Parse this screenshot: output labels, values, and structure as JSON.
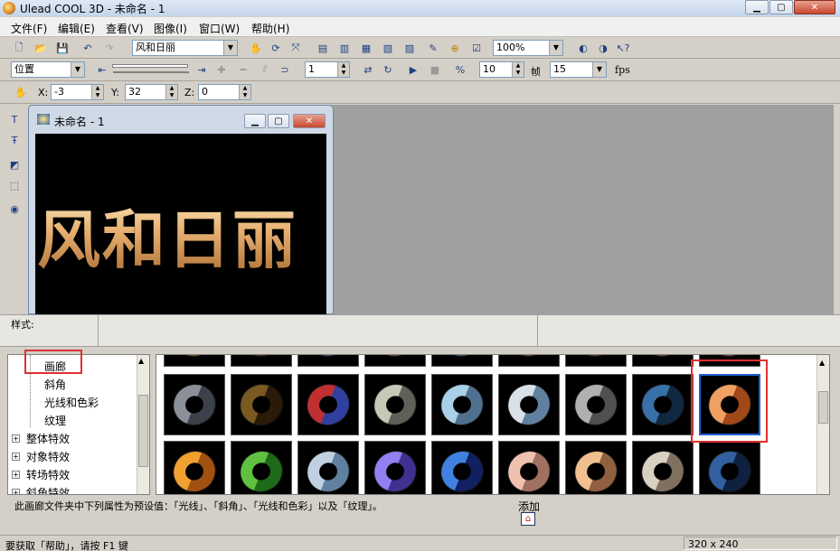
{
  "window": {
    "title": "Ulead COOL 3D - 未命名 - 1"
  },
  "menu": [
    "文件(F)",
    "编辑(E)",
    "查看(V)",
    "图像(I)",
    "窗口(W)",
    "帮助(H)"
  ],
  "toolbar1": {
    "text_object": "风和日丽",
    "zoom": "100%"
  },
  "toolbar2": {
    "mode": "位置",
    "frame": "1",
    "frames": "10",
    "frames_label": "帧",
    "fps_value": "15",
    "fps_label": "fps"
  },
  "toolbar3": {
    "x_label": "X:",
    "x_value": "-3",
    "y_label": "Y:",
    "y_value": "32",
    "z_label": "Z:",
    "z_value": "0"
  },
  "doc": {
    "title": "未命名 - 1",
    "text": "风和日丽"
  },
  "style_label": "样式:",
  "tree": {
    "items": [
      "画廊",
      "斜角",
      "光线和色彩",
      "纹理"
    ],
    "groups": [
      "整体特效",
      "对象特效",
      "转场特效",
      "斜角特效"
    ]
  },
  "description": "此画廊文件夹中下列属性为预设值：「光线」、「斜角」、「光线和色彩」以及「纹理」。",
  "add_label": "添加",
  "status": {
    "help": "要获取「帮助」，请按 F1 键",
    "size": "320 x 240"
  },
  "thumbs_row1": [
    [
      "#8a8f99",
      "#3c4048"
    ],
    [
      "#7a5a20",
      "#2a1a08"
    ],
    [
      "#c03030",
      "#3040a0"
    ],
    [
      "#c8c8b8",
      "#606058"
    ],
    [
      "#a8d0e8",
      "#507090"
    ],
    [
      "#d8e0e8",
      "#6080a0"
    ],
    [
      "#b0b0b0",
      "#505050"
    ],
    [
      "#3870a8",
      "#102840"
    ],
    [
      "#f0a060",
      "#a04818"
    ]
  ],
  "thumbs_row2": [
    [
      "#f0a030",
      "#a05010"
    ],
    [
      "#60c040",
      "#1f6a18"
    ],
    [
      "#c0d0e0",
      "#6080a0"
    ],
    [
      "#9080f0",
      "#403090"
    ],
    [
      "#4080e0",
      "#102060"
    ],
    [
      "#f0c0b0",
      "#a07060"
    ],
    [
      "#f0c090",
      "#906040"
    ],
    [
      "#d8d0c0",
      "#807060"
    ],
    [
      "#3060a0",
      "#102040"
    ]
  ],
  "thumbs_row0": [
    [
      "#e0c070",
      "#806020"
    ],
    [
      "#907060",
      "#403028"
    ],
    [
      "#c0c0d0",
      "#505068"
    ],
    [
      "#d0b090",
      "#705030"
    ],
    [
      "#a0b8d0",
      "#405878"
    ],
    [
      "#c0a080",
      "#604830"
    ],
    [
      "#b09070",
      "#504030"
    ],
    [
      "#d0a060",
      "#705020"
    ],
    [
      "#e0a070",
      "#805030"
    ]
  ]
}
